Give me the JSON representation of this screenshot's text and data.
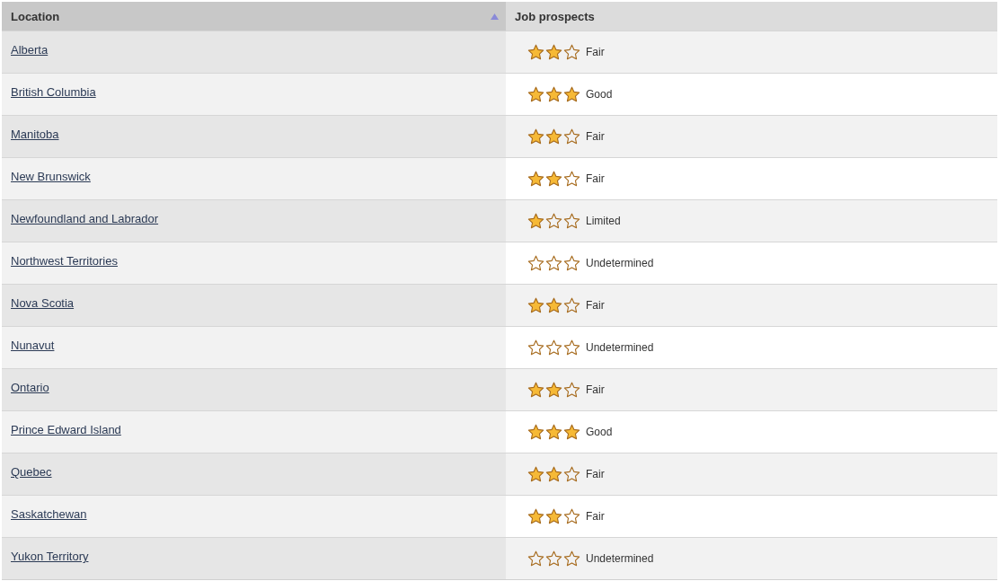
{
  "table": {
    "columns": [
      {
        "label": "Location",
        "sorted": true
      },
      {
        "label": "Job prospects",
        "sorted": false
      }
    ],
    "rows": [
      {
        "location": "Alberta",
        "stars": 2,
        "prospect": "Fair"
      },
      {
        "location": "British Columbia",
        "stars": 3,
        "prospect": "Good"
      },
      {
        "location": "Manitoba",
        "stars": 2,
        "prospect": "Fair"
      },
      {
        "location": "New Brunswick",
        "stars": 2,
        "prospect": "Fair"
      },
      {
        "location": "Newfoundland and Labrador",
        "stars": 1,
        "prospect": "Limited"
      },
      {
        "location": "Northwest Territories",
        "stars": 0,
        "prospect": "Undetermined"
      },
      {
        "location": "Nova Scotia",
        "stars": 2,
        "prospect": "Fair"
      },
      {
        "location": "Nunavut",
        "stars": 0,
        "prospect": "Undetermined"
      },
      {
        "location": "Ontario",
        "stars": 2,
        "prospect": "Fair"
      },
      {
        "location": "Prince Edward Island",
        "stars": 3,
        "prospect": "Good"
      },
      {
        "location": "Quebec",
        "stars": 2,
        "prospect": "Fair"
      },
      {
        "location": "Saskatchewan",
        "stars": 2,
        "prospect": "Fair"
      },
      {
        "location": "Yukon Territory",
        "stars": 0,
        "prospect": "Undetermined"
      }
    ]
  }
}
